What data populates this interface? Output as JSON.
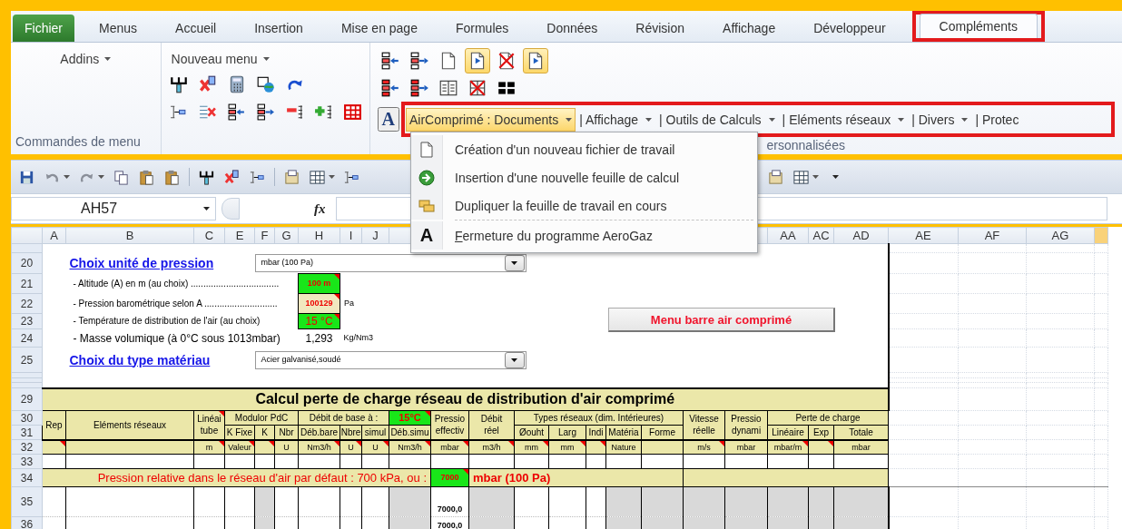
{
  "tabs": [
    {
      "label": "Fichier",
      "kind": "file",
      "selected": false,
      "highlighted": false
    },
    {
      "label": "Menus",
      "kind": "tab",
      "selected": false,
      "highlighted": false
    },
    {
      "label": "Accueil",
      "kind": "tab",
      "selected": false,
      "highlighted": false
    },
    {
      "label": "Insertion",
      "kind": "tab",
      "selected": false,
      "highlighted": false
    },
    {
      "label": "Mise en page",
      "kind": "tab",
      "selected": false,
      "highlighted": false
    },
    {
      "label": "Formules",
      "kind": "tab",
      "selected": false,
      "highlighted": false
    },
    {
      "label": "Données",
      "kind": "tab",
      "selected": false,
      "highlighted": false
    },
    {
      "label": "Révision",
      "kind": "tab",
      "selected": false,
      "highlighted": false
    },
    {
      "label": "Affichage",
      "kind": "tab",
      "selected": false,
      "highlighted": false
    },
    {
      "label": "Développeur",
      "kind": "tab",
      "selected": false,
      "highlighted": false
    },
    {
      "label": "Compléments",
      "kind": "tab",
      "selected": true,
      "highlighted": true
    }
  ],
  "ribbon": {
    "addins_menu": "Addins",
    "commands_group": "Commandes de menu",
    "new_menu": "Nouveau menu",
    "toggles": [
      {
        "pressed": false
      },
      {
        "pressed": false
      },
      {
        "pressed": false
      },
      {
        "pressed": true
      },
      {
        "pressed": false
      },
      {
        "pressed": true
      }
    ],
    "font_glyph": "A",
    "menubar": {
      "highlighted": true,
      "items": [
        {
          "label": "AirComprimé : Documents",
          "selected": true,
          "dropdown": true
        },
        {
          "label": "| Affichage",
          "selected": false,
          "dropdown": true
        },
        {
          "label": "| Outils de Calculs",
          "selected": false,
          "dropdown": true
        },
        {
          "label": "| Eléments réseaux",
          "selected": false,
          "dropdown": true
        },
        {
          "label": "| Divers",
          "selected": false,
          "dropdown": true
        },
        {
          "label": "| Protec",
          "selected": false,
          "dropdown": false
        }
      ]
    },
    "custom_group": "ersonnalisées"
  },
  "popup_menu": [
    {
      "label": "Création d'un nouveau fichier de travail",
      "separated": false,
      "underline_first": false
    },
    {
      "label": "Insertion d'une nouvelle feuille de calcul",
      "separated": false,
      "underline_first": false
    },
    {
      "label": "Dupliquer la feuille de travail en cours",
      "separated": false,
      "underline_first": false
    },
    {
      "label": "Fermeture du programme AeroGaz",
      "separated": true,
      "underline_first": true,
      "icon_glyph": "A"
    }
  ],
  "formula_bar": {
    "name_box": "AH57",
    "fx": "fx"
  },
  "sheet": {
    "columns_left": [
      "A",
      "B",
      "C",
      "E",
      "F",
      "G",
      "H",
      "I",
      "J"
    ],
    "columns_right": [
      "AA",
      "AC",
      "AD",
      "AE",
      "AF",
      "AG"
    ],
    "rows": [
      "20",
      "21",
      "22",
      "23",
      "24",
      "25",
      "29",
      "30",
      "31",
      "32",
      "33",
      "34",
      "35",
      "36"
    ],
    "pressure_unit": {
      "label": "Choix unité de pression",
      "value": "mbar (100 Pa)"
    },
    "parameters": [
      {
        "label": "- Altitude (A) en m (au choix) ...................................",
        "value": "100 m",
        "kind": "input",
        "comment": true
      },
      {
        "label": "- Pression barométrique selon A .............................",
        "value": "100129",
        "unit": "Pa",
        "kind": "computed",
        "comment": true
      },
      {
        "label": "- Température de distribution de l'air (au choix)",
        "value": "15 °C",
        "kind": "input",
        "comment": true
      },
      {
        "label": "- Masse volumique (à 0°C sous 1013mbar)",
        "value": "1,293",
        "unit": "Kg/Nm3",
        "kind": "result",
        "comment": false
      }
    ],
    "material": {
      "label": "Choix du type matériau",
      "value": "Acier galvanisé,soudé"
    },
    "macro_button": "Menu barre air comprimé",
    "table": {
      "title": "Calcul perte de charge réseau de distribution d'air comprimé",
      "header_top": [
        {
          "text": "Rep",
          "kind": "label",
          "comment": false
        },
        {
          "text": "Eléments réseaux",
          "kind": "label",
          "comment": false
        },
        {
          "text": "Linéai\ntube",
          "kind": "label",
          "comment": true
        },
        {
          "text": "Modulor PdC",
          "kind": "label",
          "comment": false
        },
        {
          "text": "Débit de base à :",
          "kind": "label",
          "comment": false
        },
        {
          "text": "15°C",
          "kind": "input",
          "comment": true
        },
        {
          "text": "Pressio\neffectiv",
          "kind": "label",
          "comment": false
        },
        {
          "text": "Débit\nréel",
          "kind": "label",
          "comment": false
        },
        {
          "text": "Types réseaux (dim. Intérieures)",
          "kind": "label",
          "comment": false
        },
        {
          "text": "Vitesse\nréelle",
          "kind": "label",
          "comment": false
        },
        {
          "text": "Pressio\ndynami",
          "kind": "label",
          "comment": false
        },
        {
          "text": "Perte de charge",
          "kind": "label",
          "comment": false
        }
      ],
      "header_bottom": [
        "K Fixe",
        "K",
        "Nbr",
        "Déb.bare",
        "Nbre",
        "simul",
        "Déb.simu",
        "Øouht",
        "Larg",
        "Indi",
        "Matéria",
        "Forme",
        "Linéaire",
        "Exp",
        "Totale"
      ],
      "units": [
        {
          "comment": true
        },
        {
          "comment": false
        },
        {
          "text": "m",
          "comment": true
        },
        {
          "text": "Valeur",
          "comment": true
        },
        {
          "comment": true
        },
        {
          "text": "U",
          "comment": false
        },
        {
          "text": "Nm3/h",
          "comment": true
        },
        {
          "text": "U",
          "comment": true
        },
        {
          "text": "U",
          "comment": true
        },
        {
          "text": "Nm3/h",
          "comment": true
        },
        {
          "text": "mbar",
          "comment": true
        },
        {
          "text": "m3/h",
          "comment": true
        },
        {
          "text": "mm",
          "comment": true
        },
        {
          "text": "mm",
          "comment": true
        },
        {
          "comment": true
        },
        {
          "text": "Nature",
          "comment": false
        },
        {
          "comment": false
        },
        {
          "text": "m/s",
          "comment": true
        },
        {
          "text": "mbar",
          "comment": false
        },
        {
          "text": "mbar/m",
          "comment": true
        },
        {
          "comment": true
        },
        {
          "text": "mbar",
          "comment": false
        }
      ],
      "default_pressure": {
        "label": "Pression relative dans le réseau d'air par défaut : 700 kPa, ou :",
        "value": "7000",
        "unit": "mbar (100 Pa)",
        "comment": true
      },
      "data_rows": [
        {
          "pressure": "7000,0"
        },
        {
          "pressure": "7000,0"
        }
      ]
    }
  }
}
